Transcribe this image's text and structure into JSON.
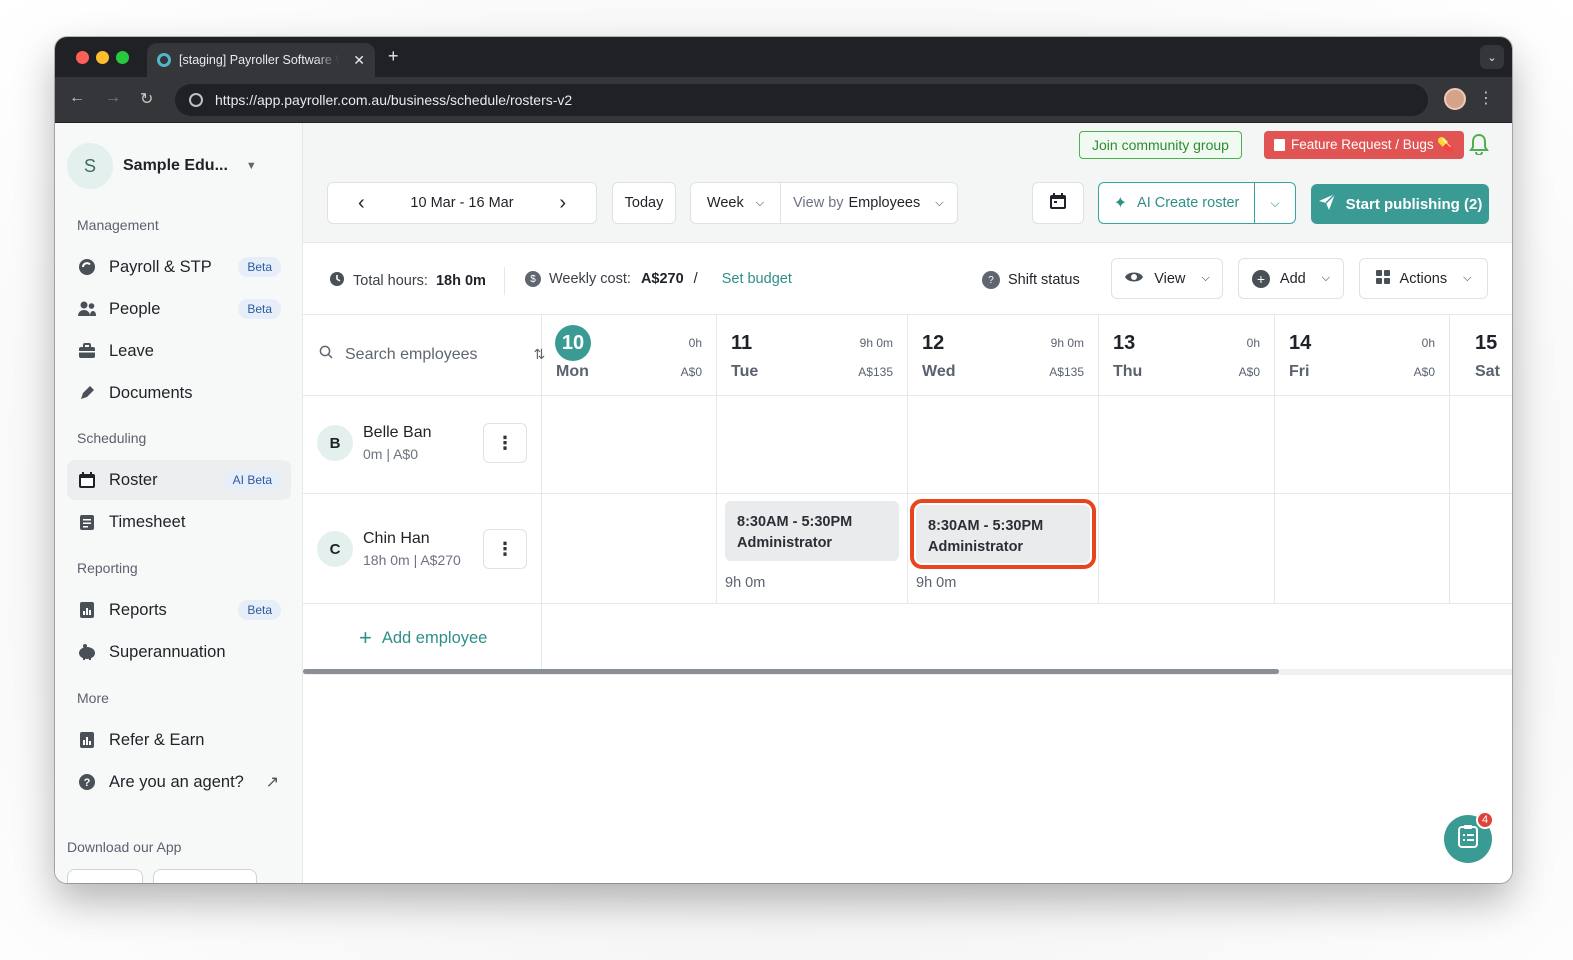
{
  "browser": {
    "tab_title": "[staging] Payroller Software W",
    "url": "https://app.payroller.com.au/business/schedule/rosters-v2"
  },
  "sidebar": {
    "org_initial": "S",
    "org_name": "Sample Edu...",
    "sections": {
      "management": "Management",
      "scheduling": "Scheduling",
      "reporting": "Reporting",
      "more": "More"
    },
    "items": {
      "payroll": {
        "label": "Payroll & STP",
        "badge": "Beta",
        "icon": "payroll-icon"
      },
      "people": {
        "label": "People",
        "badge": "Beta",
        "icon": "people-icon"
      },
      "leave": {
        "label": "Leave",
        "icon": "briefcase-icon"
      },
      "documents": {
        "label": "Documents",
        "icon": "pen-icon"
      },
      "roster": {
        "label": "Roster",
        "badge": "AI Beta",
        "icon": "calendar-icon"
      },
      "timesheet": {
        "label": "Timesheet",
        "icon": "clipboard-icon"
      },
      "reports": {
        "label": "Reports",
        "badge": "Beta",
        "icon": "report-icon"
      },
      "super": {
        "label": "Superannuation",
        "icon": "piggy-bank-icon"
      },
      "refer": {
        "label": "Refer & Earn",
        "icon": "gift-icon"
      },
      "agent": {
        "label": "Are you an agent?",
        "icon": "help-icon"
      }
    },
    "download": "Download our App"
  },
  "topbar": {
    "join": "Join community group",
    "feature": "Feature Request / Bugs 💊"
  },
  "controls": {
    "date_range": "10 Mar - 16 Mar",
    "today": "Today",
    "week": "Week",
    "view_by_prefix": "View by",
    "view_by_value": "Employees",
    "ai_create": "AI Create roster",
    "publish": "Start publishing (2)"
  },
  "stats": {
    "total_hours_label": "Total hours:",
    "total_hours_value": "18h 0m",
    "weekly_cost_label": "Weekly cost:",
    "weekly_cost_value": "A$270",
    "separator": "/",
    "set_budget": "Set budget",
    "shift_status": "Shift status",
    "view": "View",
    "add": "Add",
    "actions": "Actions"
  },
  "grid": {
    "search_placeholder": "Search employees",
    "days": [
      {
        "num": "10",
        "name": "Mon",
        "hours": "0h",
        "cost": "A$0"
      },
      {
        "num": "11",
        "name": "Tue",
        "hours": "9h 0m",
        "cost": "A$135"
      },
      {
        "num": "12",
        "name": "Wed",
        "hours": "9h 0m",
        "cost": "A$135"
      },
      {
        "num": "13",
        "name": "Thu",
        "hours": "0h",
        "cost": "A$0"
      },
      {
        "num": "14",
        "name": "Fri",
        "hours": "0h",
        "cost": "A$0"
      },
      {
        "num": "15",
        "name": "Sat"
      }
    ],
    "employees": [
      {
        "initial": "B",
        "name": "Belle Ban",
        "summary": "0m | A$0"
      },
      {
        "initial": "C",
        "name": "Chin Han",
        "summary": "18h 0m | A$270"
      }
    ],
    "shifts": [
      {
        "time": "8:30AM - 5:30PM",
        "role": "Administrator",
        "hours": "9h 0m"
      },
      {
        "time": "8:30AM - 5:30PM",
        "role": "Administrator",
        "hours": "9h 0m"
      }
    ],
    "add_employee": "Add employee"
  },
  "chat_badge": "4"
}
